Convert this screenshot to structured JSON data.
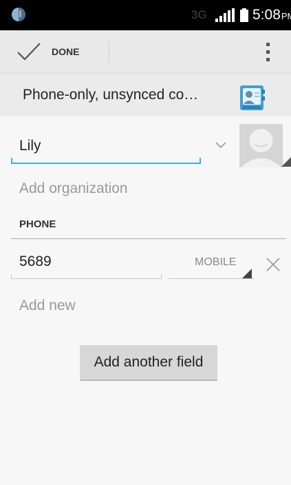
{
  "status_bar": {
    "network": "3G",
    "time": "5:08",
    "time_suffix": "PM",
    "app_icon": "notification-app-icon",
    "signal_icon": "signal-bars-icon",
    "battery_icon": "battery-icon"
  },
  "action_bar": {
    "done_label": "DONE",
    "done_icon": "checkmark-icon",
    "overflow_icon": "overflow-menu-icon"
  },
  "account": {
    "label": "Phone-only, unsynced co…",
    "icon": "contacts-app-icon"
  },
  "name": {
    "value": "Lily",
    "expand_icon": "chevron-down-icon",
    "photo_icon": "default-contact-photo-icon"
  },
  "organization": {
    "add_label": "Add organization"
  },
  "phone": {
    "header": "PHONE",
    "number": "5689",
    "type": "MOBILE",
    "remove_icon": "close-icon",
    "add_new_label": "Add new"
  },
  "add_field_button": "Add another field",
  "colors": {
    "accent": "#33b5e5",
    "status_bar_bg": "#000000",
    "action_bar_bg": "#e9e9e9",
    "page_bg": "#f7f7f7",
    "hint_text": "#999999",
    "button_bg": "#d7d7d7"
  }
}
